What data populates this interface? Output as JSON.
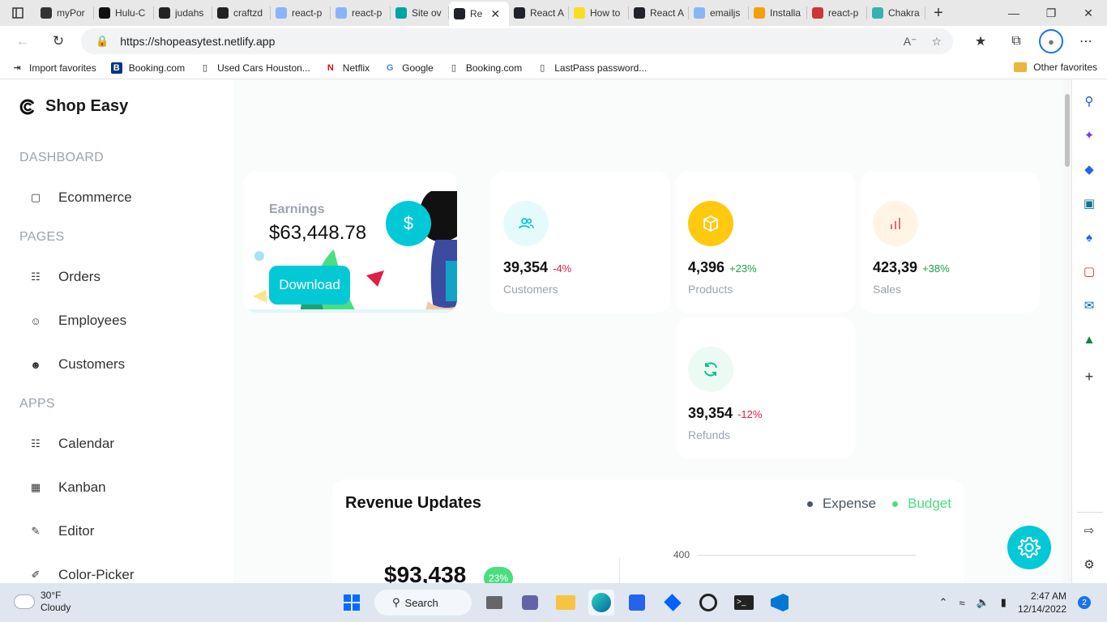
{
  "browser": {
    "tabs": [
      {
        "label": "myPor",
        "color": "#333333"
      },
      {
        "label": "Hulu-C",
        "color": "#111111"
      },
      {
        "label": "judahs",
        "color": "#222222"
      },
      {
        "label": "craftzd",
        "color": "#222222"
      },
      {
        "label": "react-p",
        "color": "#8ab4f8"
      },
      {
        "label": "react-p",
        "color": "#8ab4f8"
      },
      {
        "label": "Site ov",
        "color": "#00a3a3"
      },
      {
        "label": "Re",
        "color": "#20232a",
        "active": true
      },
      {
        "label": "React A",
        "color": "#20232a"
      },
      {
        "label": "How to",
        "color": "#f7df1e"
      },
      {
        "label": "React A",
        "color": "#20232a"
      },
      {
        "label": "emailjs",
        "color": "#8ab4f8"
      },
      {
        "label": "Installa",
        "color": "#f59e0b"
      },
      {
        "label": "react-p",
        "color": "#cb3837"
      },
      {
        "label": "Chakra",
        "color": "#38b2ac"
      }
    ],
    "url": "https://shopeasytest.netlify.app",
    "favorites": [
      {
        "label": "Import favorites",
        "icon": "import-icon"
      },
      {
        "label": "Booking.com",
        "icon": "booking-icon"
      },
      {
        "label": "Used Cars Houston...",
        "icon": "page-icon"
      },
      {
        "label": "Netflix",
        "icon": "netflix-icon"
      },
      {
        "label": "Google",
        "icon": "google-icon"
      },
      {
        "label": "Booking.com",
        "icon": "page-icon"
      },
      {
        "label": "LastPass password...",
        "icon": "page-icon"
      }
    ],
    "other_favorites": "Other favorites"
  },
  "sidebar": {
    "brand": "Shop Easy",
    "sections": [
      {
        "title": "DASHBOARD",
        "items": [
          {
            "label": "Ecommerce",
            "icon": "bag-icon"
          }
        ]
      },
      {
        "title": "PAGES",
        "items": [
          {
            "label": "Orders",
            "icon": "cart-icon"
          },
          {
            "label": "Employees",
            "icon": "employees-icon"
          },
          {
            "label": "Customers",
            "icon": "customers-icon"
          }
        ]
      },
      {
        "title": "APPS",
        "items": [
          {
            "label": "Calendar",
            "icon": "calendar-icon"
          },
          {
            "label": "Kanban",
            "icon": "kanban-icon"
          },
          {
            "label": "Editor",
            "icon": "edit-icon"
          },
          {
            "label": "Color-Picker",
            "icon": "color-picker-icon"
          }
        ]
      }
    ]
  },
  "earnings": {
    "title": "Earnings",
    "value": "$63,448.78",
    "button": "Download",
    "accent": "#03c9d7"
  },
  "stats": [
    {
      "value": "39,354",
      "change": "-4%",
      "label": "Customers",
      "icon": "customers-icon",
      "icon_color": "#03c9d7",
      "icon_bg": "#e5fafb"
    },
    {
      "value": "4,396",
      "change": "+23%",
      "label": "Products",
      "icon": "box-icon",
      "icon_color": "#ffffff",
      "icon_bg": "#fec90f"
    },
    {
      "value": "423,39",
      "change": "+38%",
      "label": "Sales",
      "icon": "bar-chart-icon",
      "icon_color": "#e46a76",
      "icon_bg": "#fff4e5"
    },
    {
      "value": "39,354",
      "change": "-12%",
      "label": "Refunds",
      "icon": "refresh-icon",
      "icon_color": "#00c292",
      "icon_bg": "#ebfaf2"
    }
  ],
  "revenue": {
    "title": "Revenue Updates",
    "legend": [
      {
        "label": "Expense",
        "color": "#4b5563"
      },
      {
        "label": "Budget",
        "color": "#4ade80"
      }
    ],
    "amount": "$93,438",
    "badge": "23%",
    "axis_tick": "400"
  },
  "taskbar": {
    "weather_temp": "30°F",
    "weather_desc": "Cloudy",
    "search": "Search",
    "time": "2:47 AM",
    "date": "12/14/2022",
    "notifications": "2"
  }
}
